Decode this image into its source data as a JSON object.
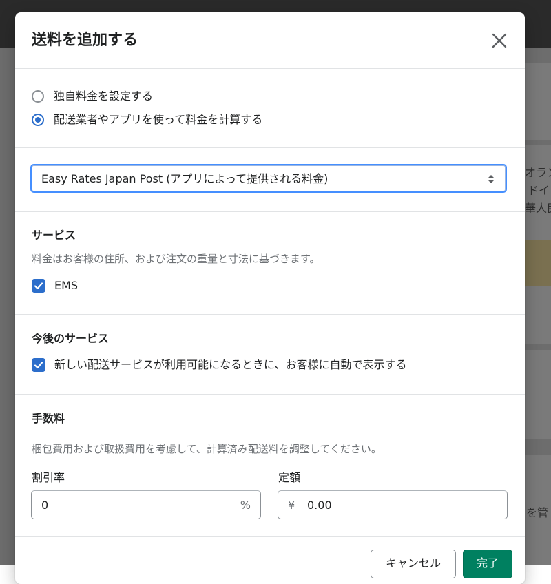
{
  "background": {
    "right_text_lines": [
      "オラン",
      "ドイ",
      "華人民"
    ],
    "right_text_bottom": "を管"
  },
  "modal": {
    "title": "送料を追加する",
    "close_icon": "close-icon",
    "rate_options": [
      {
        "label": "独自料金を設定する",
        "checked": false
      },
      {
        "label": "配送業者やアプリを使って料金を計算する",
        "checked": true
      }
    ],
    "rate_provider": {
      "selected": "Easy Rates Japan Post (アプリによって提供される料金)"
    },
    "services": {
      "heading": "サービス",
      "description": "料金はお客様の住所、および注文の重量と寸法に基づきます。",
      "items": [
        {
          "label": "EMS",
          "checked": true
        }
      ]
    },
    "future_services": {
      "heading": "今後のサービス",
      "option_label": "新しい配送サービスが利用可能になるときに、お客様に自動で表示する",
      "checked": true
    },
    "handling_fee": {
      "heading": "手数料",
      "description": "梱包費用および取扱費用を考慮して、計算済み配送料を調整してください。",
      "percentage": {
        "label": "割引率",
        "value": "0",
        "suffix": "%"
      },
      "flat": {
        "label": "定額",
        "prefix": "¥",
        "value": "0.00"
      }
    },
    "footer": {
      "cancel_label": "キャンセル",
      "done_label": "完了"
    }
  },
  "colors": {
    "primary": "#008060",
    "interactive": "#2c6ecb",
    "focus": "#458fff"
  }
}
